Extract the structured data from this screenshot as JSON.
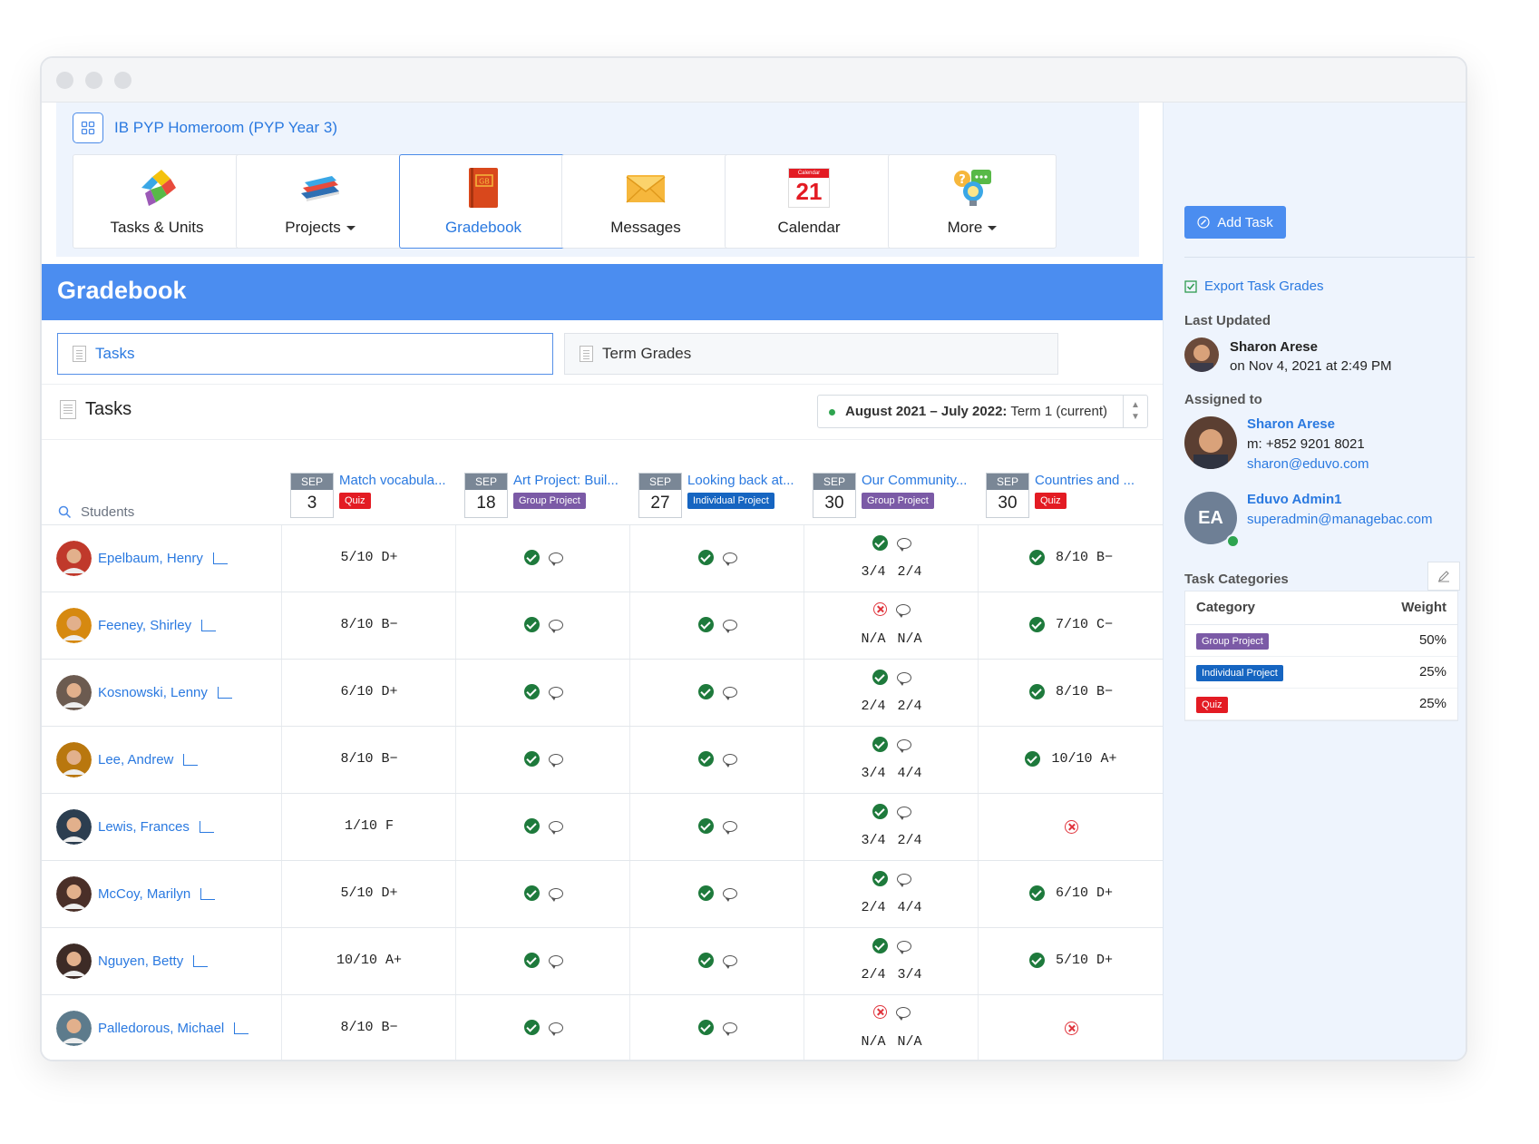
{
  "breadcrumb": {
    "title": "IB PYP Homeroom (PYP Year 3)"
  },
  "nav": [
    {
      "label": "Tasks & Units",
      "icon": "puzzle-icon",
      "caret": false
    },
    {
      "label": "Projects",
      "icon": "books-icon",
      "caret": true
    },
    {
      "label": "Gradebook",
      "icon": "gradebook-icon",
      "caret": false,
      "active": true
    },
    {
      "label": "Messages",
      "icon": "envelope-icon",
      "caret": false
    },
    {
      "label": "Calendar",
      "icon": "calendar-icon",
      "caret": false,
      "day": "21",
      "mini": "Calendar"
    },
    {
      "label": "More",
      "icon": "more-icon",
      "caret": true
    }
  ],
  "page_title": "Gradebook",
  "subtabs": {
    "tasks": "Tasks",
    "term_grades": "Term Grades"
  },
  "tasks_bar": {
    "title": "Tasks",
    "term_bold": "August 2021 – July 2022:",
    "term_rest": " Term 1 (current)"
  },
  "students_search": {
    "label": "Students"
  },
  "columns": [
    {
      "month": "SEP",
      "day": "3",
      "title": "Match vocabula...",
      "badge": "Quiz"
    },
    {
      "month": "SEP",
      "day": "18",
      "title": "Art Project: Buil...",
      "badge": "Group Project"
    },
    {
      "month": "SEP",
      "day": "27",
      "title": "Looking back at...",
      "badge": "Individual Project"
    },
    {
      "month": "SEP",
      "day": "30",
      "title": "Our Community...",
      "badge": "Group Project"
    },
    {
      "month": "SEP",
      "day": "30",
      "title": "Countries and ...",
      "badge": "Quiz"
    }
  ],
  "badge_colors": {
    "Quiz": "#e31b23",
    "Group Project": "#7b5aa6",
    "Individual Project": "#1665c1"
  },
  "students": [
    {
      "name": "Epelbaum, Henry",
      "c1": "5/10 D+",
      "c4": {
        "status": "check",
        "v": "3/4 2/4"
      },
      "c5": {
        "status": "check",
        "v": "8/10 B−"
      }
    },
    {
      "name": "Feeney, Shirley",
      "c1": "8/10 B−",
      "c4": {
        "status": "x",
        "v": "N/A N/A"
      },
      "c5": {
        "status": "check",
        "v": "7/10 C−"
      }
    },
    {
      "name": "Kosnowski, Lenny",
      "c1": "6/10 D+",
      "c4": {
        "status": "check",
        "v": "2/4 2/4"
      },
      "c5": {
        "status": "check",
        "v": "8/10 B−"
      }
    },
    {
      "name": "Lee, Andrew",
      "c1": "8/10 B−",
      "c4": {
        "status": "check",
        "v": "3/4 4/4"
      },
      "c5": {
        "status": "check",
        "v": "10/10 A+"
      }
    },
    {
      "name": "Lewis, Frances",
      "c1": "1/10 F",
      "c4": {
        "status": "check",
        "v": "3/4 2/4"
      },
      "c5": {
        "status": "x",
        "v": ""
      }
    },
    {
      "name": "McCoy, Marilyn",
      "c1": "5/10 D+",
      "c4": {
        "status": "check",
        "v": "2/4 4/4"
      },
      "c5": {
        "status": "check",
        "v": "6/10 D+"
      }
    },
    {
      "name": "Nguyen, Betty",
      "c1": "10/10 A+",
      "c4": {
        "status": "check",
        "v": "2/4 3/4"
      },
      "c5": {
        "status": "check",
        "v": "5/10 D+"
      }
    },
    {
      "name": "Palledorous, Michael",
      "c1": "8/10 B−",
      "c4": {
        "status": "x",
        "v": "N/A N/A"
      },
      "c5": {
        "status": "x",
        "v": ""
      }
    }
  ],
  "sidebar": {
    "add_task": "Add Task",
    "export": "Export Task Grades",
    "last_updated_label": "Last Updated",
    "last_updated_name": "Sharon Arese",
    "last_updated_when": "on Nov 4, 2021 at 2:49 PM",
    "assigned_label": "Assigned to",
    "assignee1": {
      "name": "Sharon Arese",
      "phone": "m: +852 9201 8021",
      "email": "sharon@eduvo.com"
    },
    "assignee2": {
      "initials": "EA",
      "name": "Eduvo Admin1",
      "email": "superadmin@managebac.com"
    },
    "categories_label": "Task Categories",
    "cat_head": {
      "category": "Category",
      "weight": "Weight"
    },
    "categories": [
      {
        "name": "Group Project",
        "weight": "50%"
      },
      {
        "name": "Individual Project",
        "weight": "25%"
      },
      {
        "name": "Quiz",
        "weight": "25%"
      }
    ]
  }
}
